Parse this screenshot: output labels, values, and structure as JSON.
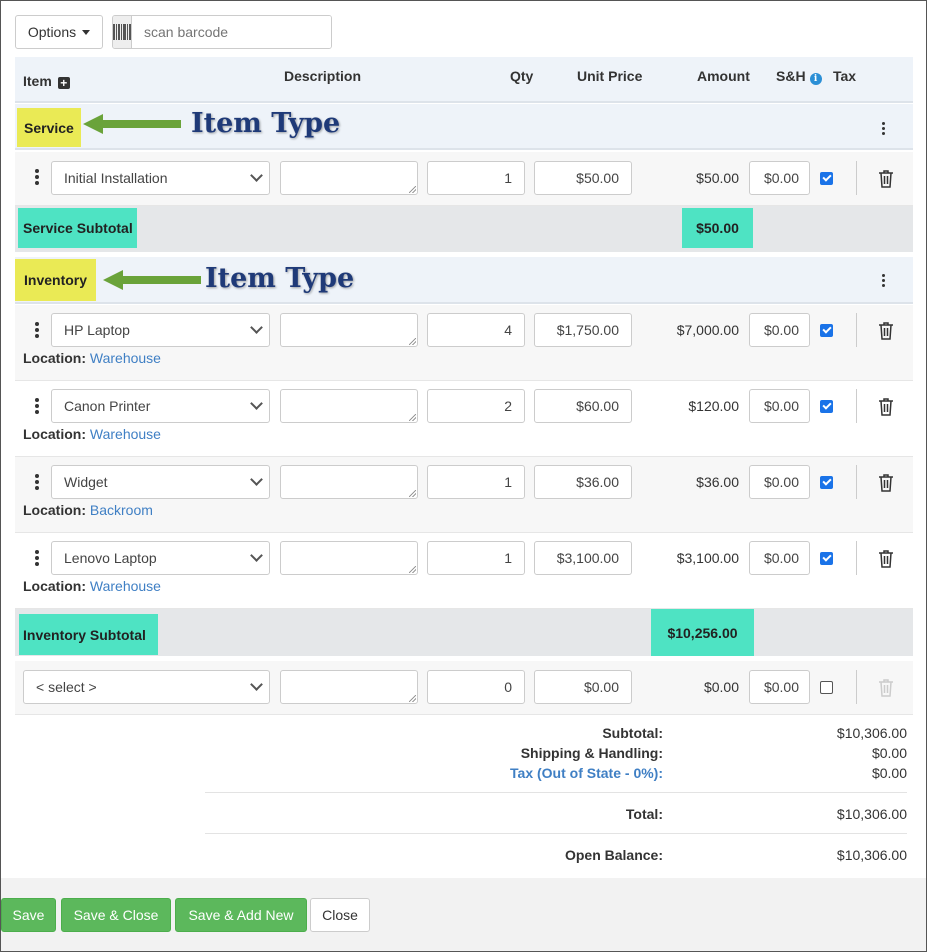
{
  "toolbar": {
    "options_label": "Options",
    "scan_placeholder": "scan barcode"
  },
  "columns": {
    "item": "Item",
    "description": "Description",
    "qty": "Qty",
    "unit_price": "Unit Price",
    "amount": "Amount",
    "sh": "S&H",
    "tax": "Tax"
  },
  "groups": [
    {
      "label": "Service",
      "annotation": "Item Type",
      "subtotal_label": "Service Subtotal",
      "subtotal_value": "$50.00",
      "rows": [
        {
          "item": "Initial Installation",
          "qty": "1",
          "unit_price": "$50.00",
          "amount": "$50.00",
          "sh": "$0.00",
          "tax": true
        }
      ]
    },
    {
      "label": "Inventory",
      "annotation": "Item Type",
      "subtotal_label": "Inventory Subtotal",
      "subtotal_value": "$10,256.00",
      "rows": [
        {
          "item": "HP Laptop",
          "qty": "4",
          "unit_price": "$1,750.00",
          "amount": "$7,000.00",
          "sh": "$0.00",
          "tax": true,
          "location_label": "Location:",
          "location": "Warehouse"
        },
        {
          "item": "Canon Printer",
          "qty": "2",
          "unit_price": "$60.00",
          "amount": "$120.00",
          "sh": "$0.00",
          "tax": true,
          "location_label": "Location:",
          "location": "Warehouse"
        },
        {
          "item": "Widget",
          "qty": "1",
          "unit_price": "$36.00",
          "amount": "$36.00",
          "sh": "$0.00",
          "tax": true,
          "location_label": "Location:",
          "location": "Backroom"
        },
        {
          "item": "Lenovo Laptop",
          "qty": "1",
          "unit_price": "$3,100.00",
          "amount": "$3,100.00",
          "sh": "$0.00",
          "tax": true,
          "location_label": "Location:",
          "location": "Warehouse"
        }
      ]
    }
  ],
  "new_row": {
    "item": "< select >",
    "qty": "0",
    "unit_price": "$0.00",
    "amount": "$0.00",
    "sh": "$0.00",
    "tax": false
  },
  "totals": {
    "subtotal_label": "Subtotal:",
    "subtotal": "$10,306.00",
    "shipping_label": "Shipping & Handling:",
    "shipping": "$0.00",
    "tax_label": "Tax (Out of State - 0%):",
    "tax": "$0.00",
    "total_label": "Total:",
    "total": "$10,306.00",
    "balance_label": "Open Balance:",
    "balance": "$10,306.00"
  },
  "footer": {
    "save": "Save",
    "save_close": "Save & Close",
    "save_add_new": "Save & Add New",
    "close": "Close"
  },
  "colors": {
    "highlight_yellow": "#eaea55",
    "highlight_teal": "#4ee3c3",
    "arrow_green": "#6aa33a",
    "annotation_blue": "#1f3a78",
    "button_green": "#5cb85c",
    "link_blue": "#3f7fc4"
  }
}
